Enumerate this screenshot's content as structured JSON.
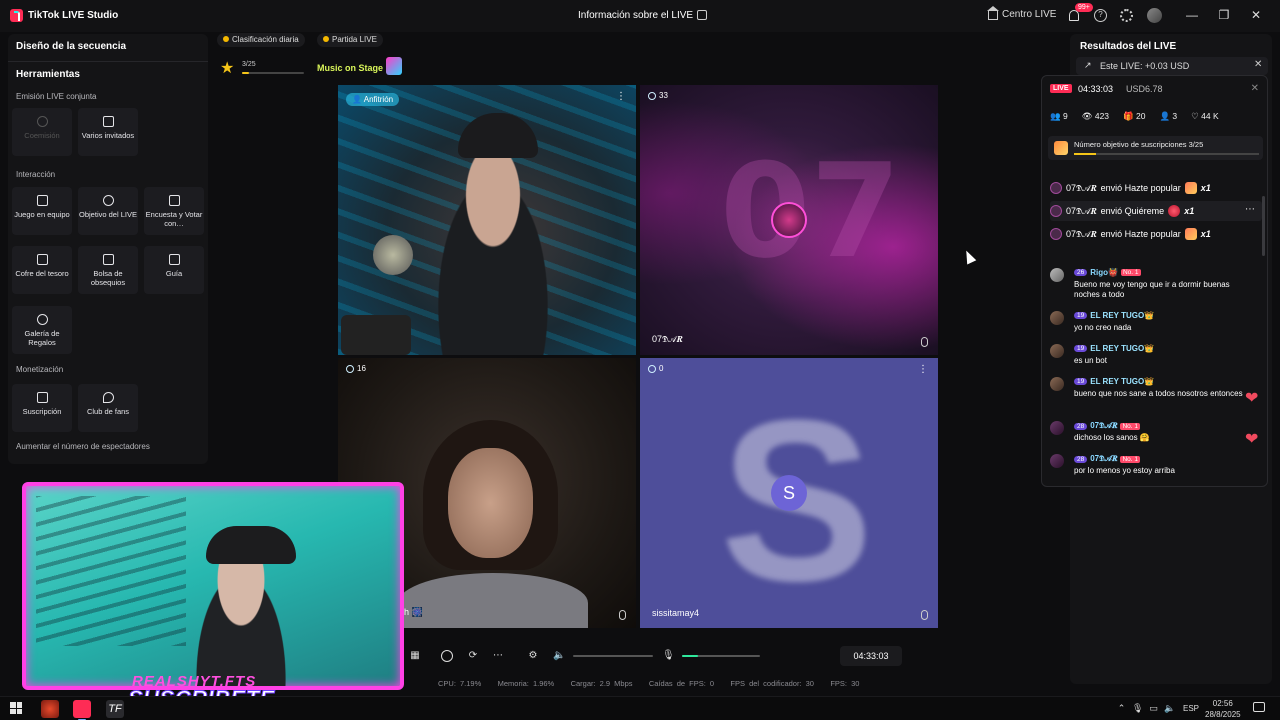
{
  "window": {
    "app_title": "TikTok LIVE Studio",
    "live_info": "Información sobre el LIVE",
    "centro_live": "Centro LIVE",
    "notif_count": "99+",
    "controls": {
      "minimize": "—",
      "maximize": "❐",
      "close": "✕"
    }
  },
  "left_panel": {
    "header": "Diseño de la secuencia",
    "tools_title": "Herramientas",
    "sections": {
      "cohost": "Emisión LIVE conjunta",
      "interaction": "Interacción",
      "monetization": "Monetización"
    },
    "cohost_tiles": [
      {
        "label": "Coemisión",
        "icon": "link-icon"
      },
      {
        "label": "Varios invitados",
        "icon": "guests-icon"
      }
    ],
    "interaction_tiles": [
      {
        "label": "Juego en equipo",
        "icon": "team-game-icon"
      },
      {
        "label": "Objetivo del LIVE",
        "icon": "goal-icon"
      },
      {
        "label": "Encuesta y Votar con…",
        "icon": "poll-icon"
      },
      {
        "label": "Cofre del tesoro",
        "icon": "treasure-icon"
      },
      {
        "label": "Bolsa de obsequios",
        "icon": "gift-bag-icon"
      },
      {
        "label": "Guía",
        "icon": "guide-icon"
      },
      {
        "label": "Galería de Regalos",
        "icon": "gift-gallery-icon"
      }
    ],
    "monetization_tiles": [
      {
        "label": "Suscripción",
        "icon": "subscription-icon"
      },
      {
        "label": "Club de fans",
        "icon": "fan-club-icon"
      }
    ],
    "aumentar": "Aumentar el número de espectadores"
  },
  "top_chips": {
    "ranking": "Clasificación diaria",
    "match": "Partida LIVE"
  },
  "goal_progress": {
    "text": "3/25",
    "fraction": 0.12
  },
  "music": {
    "label": "Music on Stage"
  },
  "grid": {
    "host_badge": "Anfitrión",
    "tiles": [
      {
        "viewers": "",
        "name": ""
      },
      {
        "viewers": "33",
        "name": "07𝕯𝒜𝑹"
      },
      {
        "viewers": "16",
        "name": "h 🎆"
      },
      {
        "viewers": "0",
        "name": "sissitamay4"
      }
    ],
    "s_letter": "S"
  },
  "overlay": {
    "name": "REALSHYT.FTS",
    "cta": "SUSCRIBETE"
  },
  "controls": {
    "audio_level": 0.0,
    "mic_level": 0.2,
    "timer": "04:33:03"
  },
  "stats_line": {
    "cpu": "CPU: 7.19%",
    "memory": "Memoria: 1.96%",
    "upload": "Cargar: 2.9 Mbps",
    "fps_drops": "Caídas de FPS: 0",
    "encoder_fps": "FPS del codificador: 30",
    "fps": "FPS: 30"
  },
  "right_panel": {
    "title": "Resultados del LIVE",
    "earn": "Este LIVE: +0.03 USD"
  },
  "popup": {
    "live_badge": "LIVE",
    "time": "04:33:03",
    "usd": "USD6.78",
    "stats": [
      "9",
      "423",
      "20",
      "3",
      "44 K"
    ],
    "goal_text": "Número objetivo de suscripciones 3/25",
    "goal_fraction": 0.12,
    "gifts": [
      {
        "user": "07𝕯𝒜𝑹",
        "action": "envió Hazte popular",
        "count": "x1"
      },
      {
        "user": "07𝕯𝒜𝑹",
        "action": "envió Quiéreme",
        "count": "x1"
      },
      {
        "user": "07𝕯𝒜𝑹",
        "action": "envió Hazte popular",
        "count": "x1"
      }
    ],
    "chat": [
      {
        "level": "26",
        "user": "Rigo👹",
        "fan": "No. 1",
        "text": "Bueno me voy tengo que ir a dormir buenas noches a todo"
      },
      {
        "level": "19",
        "user": "EL REY TUGO👑",
        "fan": "",
        "text": "yo no creo nada"
      },
      {
        "level": "19",
        "user": "EL REY TUGO👑",
        "fan": "",
        "text": "es un bot"
      },
      {
        "level": "19",
        "user": "EL REY TUGO👑",
        "fan": "",
        "text": "bueno que nos sane a todos nosotros entonces"
      },
      {
        "level": "28",
        "user": "07𝕯𝒜𝑹",
        "fan": "No. 1",
        "text": "dichoso los sanos 🤗"
      },
      {
        "level": "28",
        "user": "07𝕯𝒜𝑹",
        "fan": "No. 1",
        "text": "por lo menos yo estoy arriba"
      }
    ]
  },
  "taskbar": {
    "lang": "ESP",
    "time": "02:56",
    "date": "28/8/2025"
  }
}
